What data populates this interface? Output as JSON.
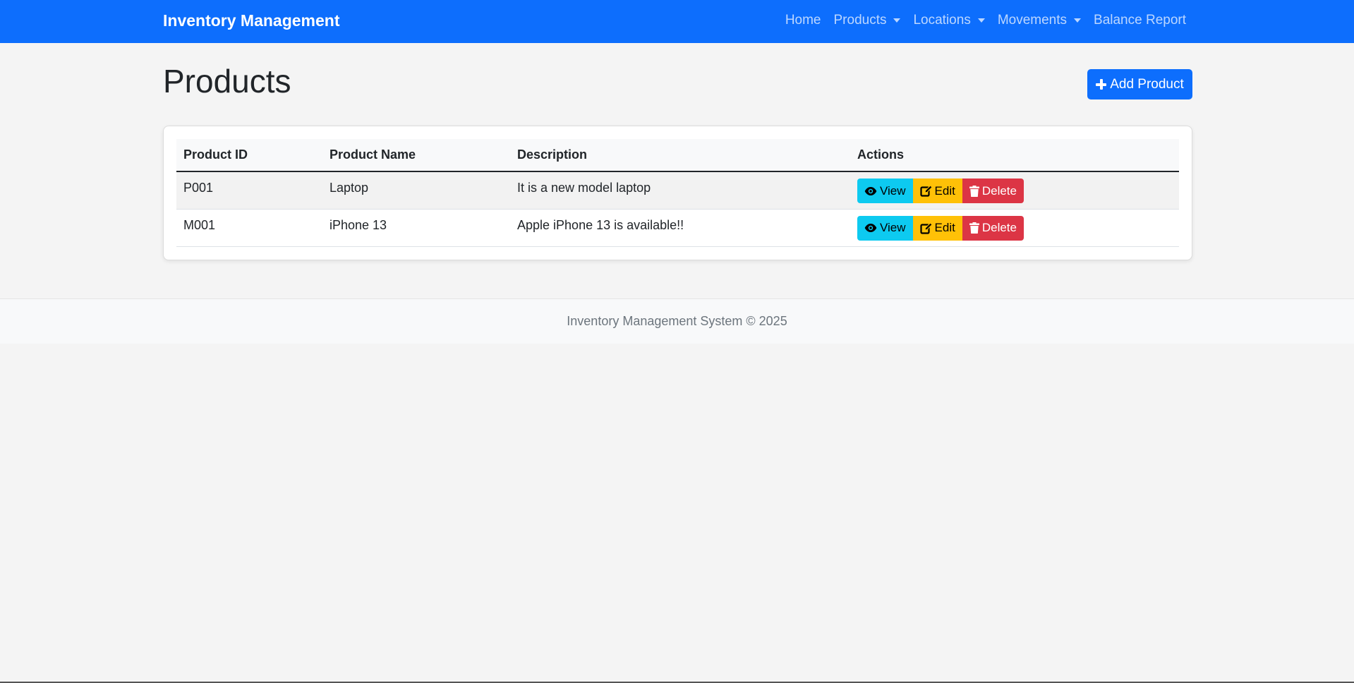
{
  "navbar": {
    "brand": "Inventory Management",
    "items": [
      {
        "label": "Home",
        "dropdown": false
      },
      {
        "label": "Products",
        "dropdown": true
      },
      {
        "label": "Locations",
        "dropdown": true
      },
      {
        "label": "Movements",
        "dropdown": true
      },
      {
        "label": "Balance Report",
        "dropdown": false
      }
    ]
  },
  "page": {
    "title": "Products",
    "add_button_label": "Add Product"
  },
  "table": {
    "headers": [
      "Product ID",
      "Product Name",
      "Description",
      "Actions"
    ],
    "rows": [
      {
        "id": "P001",
        "name": "Laptop",
        "description": "It is a new model laptop"
      },
      {
        "id": "M001",
        "name": "iPhone 13",
        "description": "Apple iPhone 13 is available!!"
      }
    ],
    "actions": {
      "view": "View",
      "edit": "Edit",
      "delete": "Delete"
    }
  },
  "footer": {
    "text": "Inventory Management System © 2025"
  },
  "colors": {
    "primary": "#0d6efd",
    "info": "#0dcaf0",
    "warning": "#ffc107",
    "danger": "#dc3545"
  }
}
